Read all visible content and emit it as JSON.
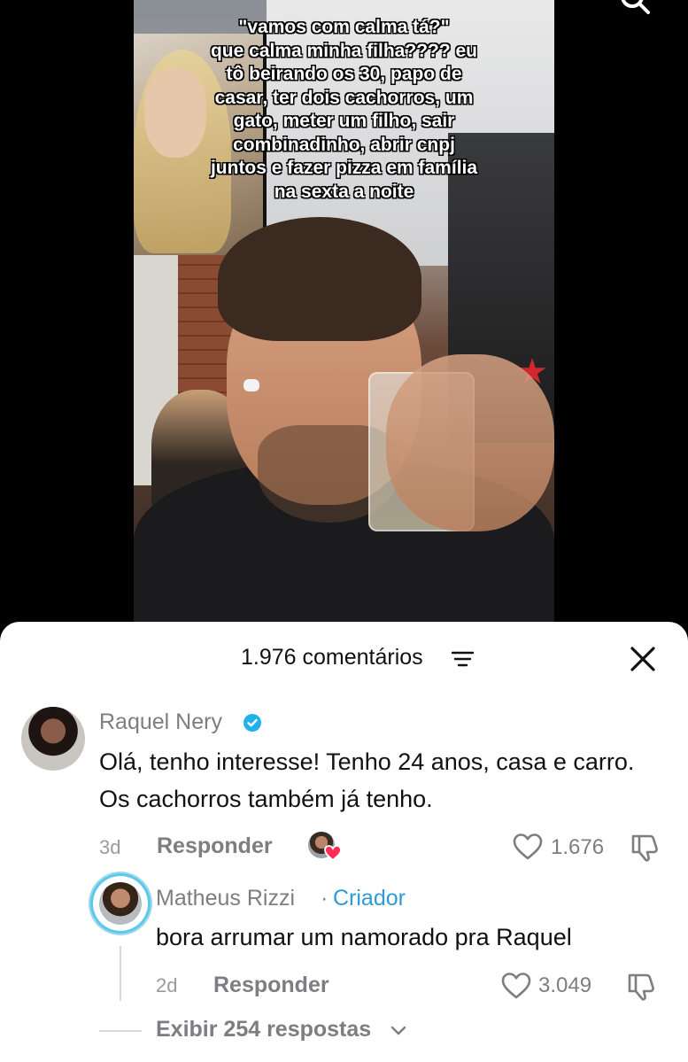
{
  "video": {
    "overlay_lines": [
      "\"vamos com calma tá?\"",
      "que calma minha filha???? eu",
      "tô beirando os 30, papo de",
      "casar, ter dois cachorros, um",
      "gato, meter um filho, sair",
      "combinadinho, abrir cnpj",
      "juntos e fazer pizza em família",
      "na sexta a noite"
    ]
  },
  "comments_sheet": {
    "title": "1.976 comentários",
    "filter_icon": "filter-lines-icon",
    "close_icon": "close-icon"
  },
  "comments": [
    {
      "username": "Raquel Nery",
      "verified": true,
      "text": "Olá, tenho interesse! Tenho 24 anos, casa e carro. Os cachorros também já tenho.",
      "time": "3d",
      "reply_label": "Responder",
      "creator_liked": true,
      "likes": "1.676"
    }
  ],
  "reply": {
    "username": "Matheus Rizzi",
    "separator": "·",
    "badge": "Criador",
    "text": "bora arrumar um namorado pra Raquel",
    "time": "2d",
    "reply_label": "Responder",
    "likes": "3.049"
  },
  "view_replies": "Exibir 254 respostas",
  "colors": {
    "verified": "#20b2e8",
    "creator_badge": "#2f9bd6",
    "heart_badge": "#fe2c55"
  }
}
